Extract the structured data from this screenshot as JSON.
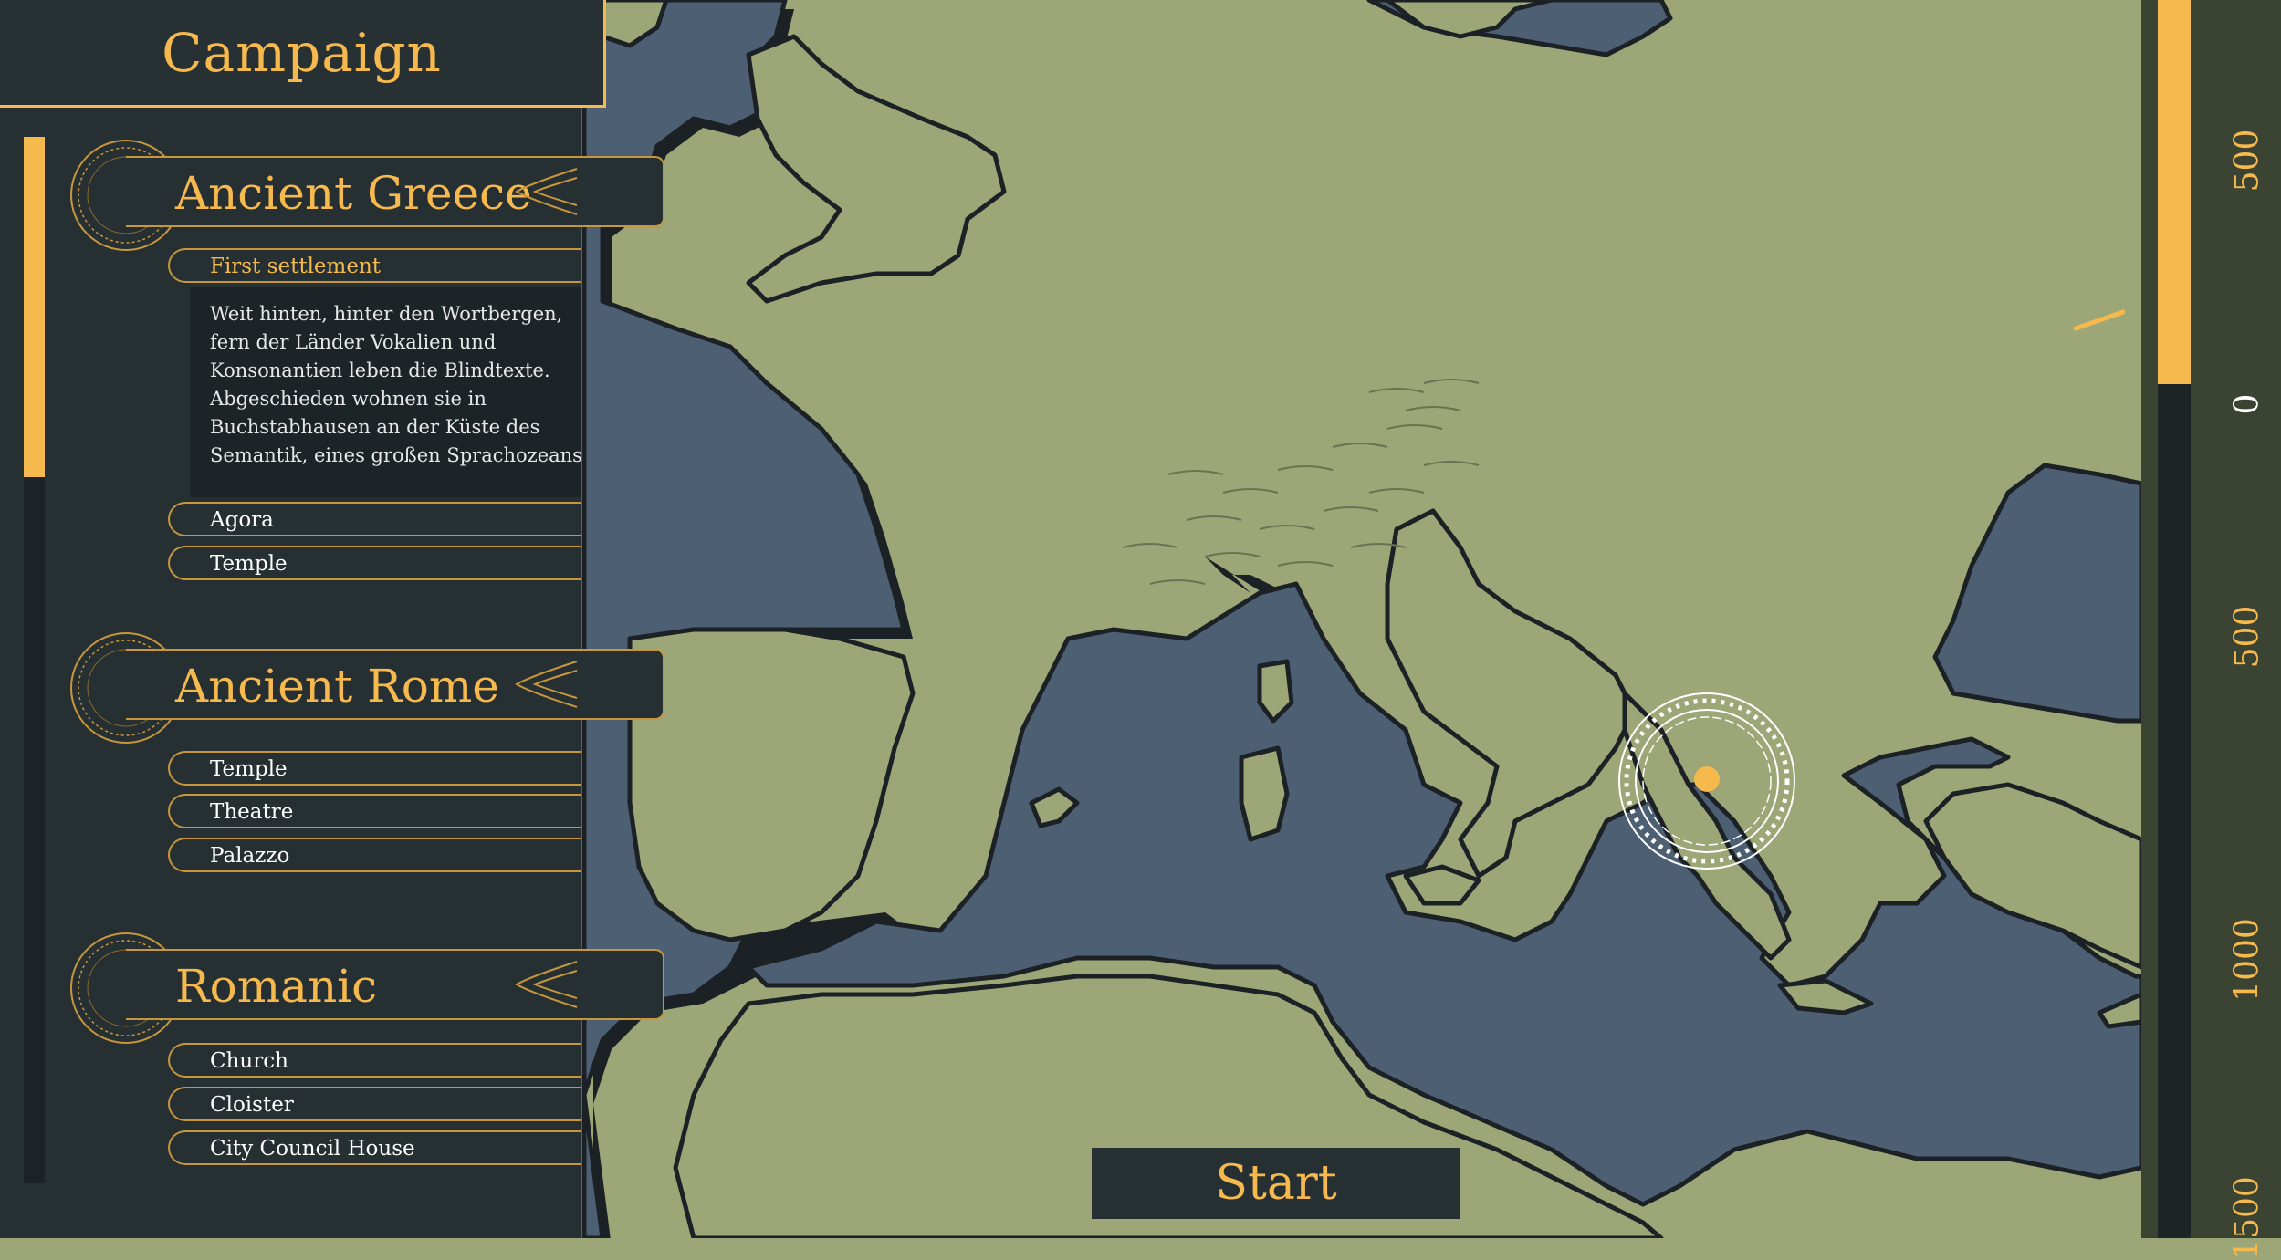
{
  "title": "Campaign",
  "eras": [
    {
      "name": "Ancient Greece",
      "items": [
        {
          "label": "First settlement",
          "selected": true
        },
        {
          "label": "Agora",
          "selected": false
        },
        {
          "label": "Temple",
          "selected": false
        }
      ],
      "description": [
        "Weit hinten, hinter den Wortbergen,",
        "fern der Länder Vokalien und",
        "Konsonantien leben die Blindtexte.",
        "Abgeschieden wohnen sie in",
        "Buchstabhausen an der Küste des",
        "Semantik, eines großen Sprachozeans"
      ]
    },
    {
      "name": "Ancient Rome",
      "items": [
        {
          "label": "Temple"
        },
        {
          "label": "Theatre"
        },
        {
          "label": "Palazzo"
        }
      ]
    },
    {
      "name": "Romanic",
      "items": [
        {
          "label": "Church"
        },
        {
          "label": "Cloister"
        },
        {
          "label": "City Council House"
        }
      ]
    }
  ],
  "start_label": "Start",
  "timeline": {
    "ticks": [
      "500",
      "0",
      "500",
      "1000",
      "1500"
    ],
    "progress_fraction": 0.31
  },
  "colors": {
    "accent": "#f6b94e",
    "panel": "#263033",
    "sea": "#4d5f73",
    "land": "#9da677"
  }
}
